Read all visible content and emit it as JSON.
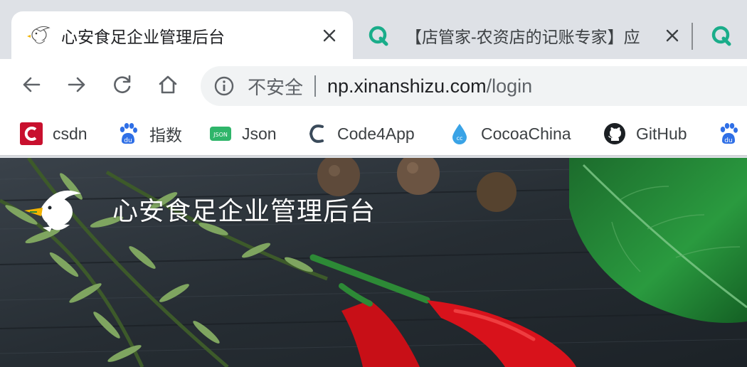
{
  "tabs": [
    {
      "title": "心安食足企业管理后台",
      "active": true,
      "favicon": "duck-logo-icon"
    },
    {
      "title": "【店管家-农资店的记账专家】应",
      "active": false,
      "favicon": "q-logo-icon"
    },
    {
      "title": "",
      "active": false,
      "favicon": "q-logo-icon"
    }
  ],
  "toolbar": {
    "security_label": "不安全",
    "url_host": "np.xinanshizu.com",
    "url_path": "/login"
  },
  "bookmarks": [
    {
      "label": "csdn",
      "icon": "csdn-icon"
    },
    {
      "label": "指数",
      "icon": "baidu-paw-icon"
    },
    {
      "label": "Json",
      "icon": "json-icon"
    },
    {
      "label": "Code4App",
      "icon": "code4app-icon"
    },
    {
      "label": "CocoaChina",
      "icon": "cocoachina-icon"
    },
    {
      "label": "GitHub",
      "icon": "github-icon"
    },
    {
      "label": "",
      "icon": "baidu-paw-icon"
    }
  ],
  "page": {
    "brand_title": "心安食足企业管理后台"
  },
  "colors": {
    "tab_strip": "#dee1e6",
    "q_green": "#1aad8a",
    "csdn_red": "#c8102e",
    "baidu_blue": "#2f6fe6",
    "json_green": "#2fb56a",
    "chili_red": "#d8121b",
    "leaf_green": "#1f8a3a"
  }
}
